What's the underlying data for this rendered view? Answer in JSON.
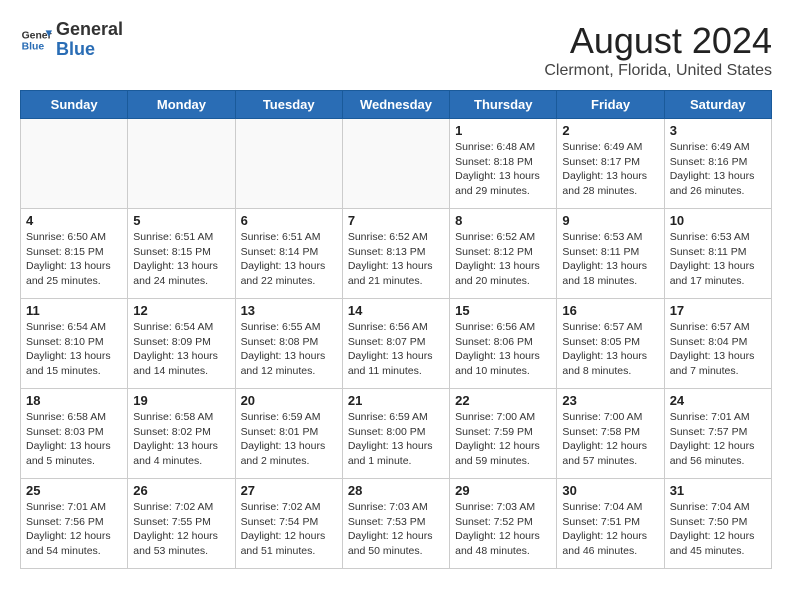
{
  "header": {
    "logo_general": "General",
    "logo_blue": "Blue",
    "month_title": "August 2024",
    "subtitle": "Clermont, Florida, United States"
  },
  "weekdays": [
    "Sunday",
    "Monday",
    "Tuesday",
    "Wednesday",
    "Thursday",
    "Friday",
    "Saturday"
  ],
  "weeks": [
    [
      {
        "day": "",
        "info": ""
      },
      {
        "day": "",
        "info": ""
      },
      {
        "day": "",
        "info": ""
      },
      {
        "day": "",
        "info": ""
      },
      {
        "day": "1",
        "info": "Sunrise: 6:48 AM\nSunset: 8:18 PM\nDaylight: 13 hours\nand 29 minutes."
      },
      {
        "day": "2",
        "info": "Sunrise: 6:49 AM\nSunset: 8:17 PM\nDaylight: 13 hours\nand 28 minutes."
      },
      {
        "day": "3",
        "info": "Sunrise: 6:49 AM\nSunset: 8:16 PM\nDaylight: 13 hours\nand 26 minutes."
      }
    ],
    [
      {
        "day": "4",
        "info": "Sunrise: 6:50 AM\nSunset: 8:15 PM\nDaylight: 13 hours\nand 25 minutes."
      },
      {
        "day": "5",
        "info": "Sunrise: 6:51 AM\nSunset: 8:15 PM\nDaylight: 13 hours\nand 24 minutes."
      },
      {
        "day": "6",
        "info": "Sunrise: 6:51 AM\nSunset: 8:14 PM\nDaylight: 13 hours\nand 22 minutes."
      },
      {
        "day": "7",
        "info": "Sunrise: 6:52 AM\nSunset: 8:13 PM\nDaylight: 13 hours\nand 21 minutes."
      },
      {
        "day": "8",
        "info": "Sunrise: 6:52 AM\nSunset: 8:12 PM\nDaylight: 13 hours\nand 20 minutes."
      },
      {
        "day": "9",
        "info": "Sunrise: 6:53 AM\nSunset: 8:11 PM\nDaylight: 13 hours\nand 18 minutes."
      },
      {
        "day": "10",
        "info": "Sunrise: 6:53 AM\nSunset: 8:11 PM\nDaylight: 13 hours\nand 17 minutes."
      }
    ],
    [
      {
        "day": "11",
        "info": "Sunrise: 6:54 AM\nSunset: 8:10 PM\nDaylight: 13 hours\nand 15 minutes."
      },
      {
        "day": "12",
        "info": "Sunrise: 6:54 AM\nSunset: 8:09 PM\nDaylight: 13 hours\nand 14 minutes."
      },
      {
        "day": "13",
        "info": "Sunrise: 6:55 AM\nSunset: 8:08 PM\nDaylight: 13 hours\nand 12 minutes."
      },
      {
        "day": "14",
        "info": "Sunrise: 6:56 AM\nSunset: 8:07 PM\nDaylight: 13 hours\nand 11 minutes."
      },
      {
        "day": "15",
        "info": "Sunrise: 6:56 AM\nSunset: 8:06 PM\nDaylight: 13 hours\nand 10 minutes."
      },
      {
        "day": "16",
        "info": "Sunrise: 6:57 AM\nSunset: 8:05 PM\nDaylight: 13 hours\nand 8 minutes."
      },
      {
        "day": "17",
        "info": "Sunrise: 6:57 AM\nSunset: 8:04 PM\nDaylight: 13 hours\nand 7 minutes."
      }
    ],
    [
      {
        "day": "18",
        "info": "Sunrise: 6:58 AM\nSunset: 8:03 PM\nDaylight: 13 hours\nand 5 minutes."
      },
      {
        "day": "19",
        "info": "Sunrise: 6:58 AM\nSunset: 8:02 PM\nDaylight: 13 hours\nand 4 minutes."
      },
      {
        "day": "20",
        "info": "Sunrise: 6:59 AM\nSunset: 8:01 PM\nDaylight: 13 hours\nand 2 minutes."
      },
      {
        "day": "21",
        "info": "Sunrise: 6:59 AM\nSunset: 8:00 PM\nDaylight: 13 hours\nand 1 minute."
      },
      {
        "day": "22",
        "info": "Sunrise: 7:00 AM\nSunset: 7:59 PM\nDaylight: 12 hours\nand 59 minutes."
      },
      {
        "day": "23",
        "info": "Sunrise: 7:00 AM\nSunset: 7:58 PM\nDaylight: 12 hours\nand 57 minutes."
      },
      {
        "day": "24",
        "info": "Sunrise: 7:01 AM\nSunset: 7:57 PM\nDaylight: 12 hours\nand 56 minutes."
      }
    ],
    [
      {
        "day": "25",
        "info": "Sunrise: 7:01 AM\nSunset: 7:56 PM\nDaylight: 12 hours\nand 54 minutes."
      },
      {
        "day": "26",
        "info": "Sunrise: 7:02 AM\nSunset: 7:55 PM\nDaylight: 12 hours\nand 53 minutes."
      },
      {
        "day": "27",
        "info": "Sunrise: 7:02 AM\nSunset: 7:54 PM\nDaylight: 12 hours\nand 51 minutes."
      },
      {
        "day": "28",
        "info": "Sunrise: 7:03 AM\nSunset: 7:53 PM\nDaylight: 12 hours\nand 50 minutes."
      },
      {
        "day": "29",
        "info": "Sunrise: 7:03 AM\nSunset: 7:52 PM\nDaylight: 12 hours\nand 48 minutes."
      },
      {
        "day": "30",
        "info": "Sunrise: 7:04 AM\nSunset: 7:51 PM\nDaylight: 12 hours\nand 46 minutes."
      },
      {
        "day": "31",
        "info": "Sunrise: 7:04 AM\nSunset: 7:50 PM\nDaylight: 12 hours\nand 45 minutes."
      }
    ]
  ]
}
